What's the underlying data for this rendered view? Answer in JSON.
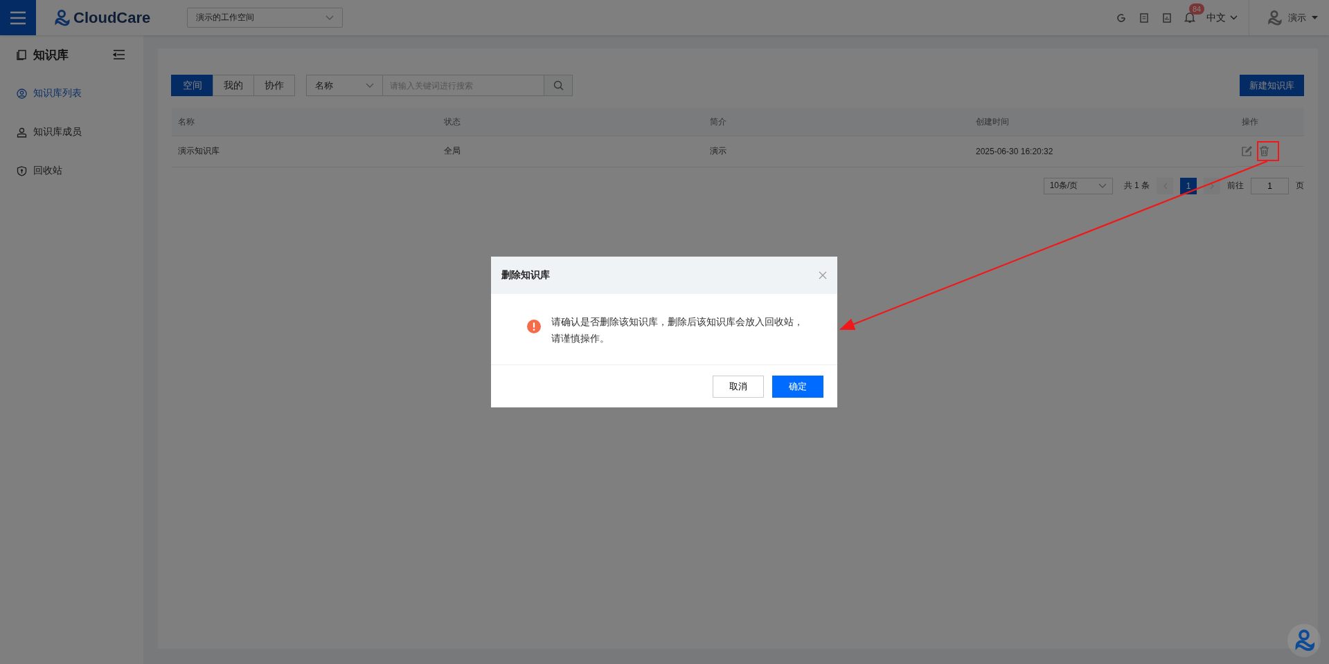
{
  "header": {
    "logo": "CloudCare",
    "workspace": "演示的工作空间",
    "notification_count": "84",
    "language": "中文",
    "user": "演示"
  },
  "sidebar": {
    "title": "知识库",
    "items": [
      {
        "label": "知识库列表",
        "selected": true
      },
      {
        "label": "知识库成员",
        "selected": false
      },
      {
        "label": "回收站",
        "selected": false
      }
    ]
  },
  "tabs": [
    {
      "label": "空间",
      "selected": true
    },
    {
      "label": "我的",
      "selected": false
    },
    {
      "label": "协作",
      "selected": false
    }
  ],
  "search": {
    "field": "名称",
    "placeholder": "请输入关键词进行搜索"
  },
  "new_button": "新建知识库",
  "table": {
    "columns": [
      "名称",
      "状态",
      "简介",
      "创建时间",
      "操作"
    ],
    "rows": [
      {
        "cells": [
          "演示知识库",
          "全局",
          "演示",
          "2025-06-30 16:20:32"
        ]
      }
    ]
  },
  "pagination": {
    "page_size": "10条/页",
    "total": "共 1 条",
    "pages": [
      {
        "label": "1",
        "selected": true
      }
    ],
    "goto": "前往",
    "goto_value": "1",
    "page_unit": "页"
  },
  "dialog": {
    "title": "删除知识库",
    "message": "请确认是否删除该知识库，删除后该知识库会放入回收站，请谨慎操作。",
    "cancel": "取消",
    "confirm": "确定"
  }
}
